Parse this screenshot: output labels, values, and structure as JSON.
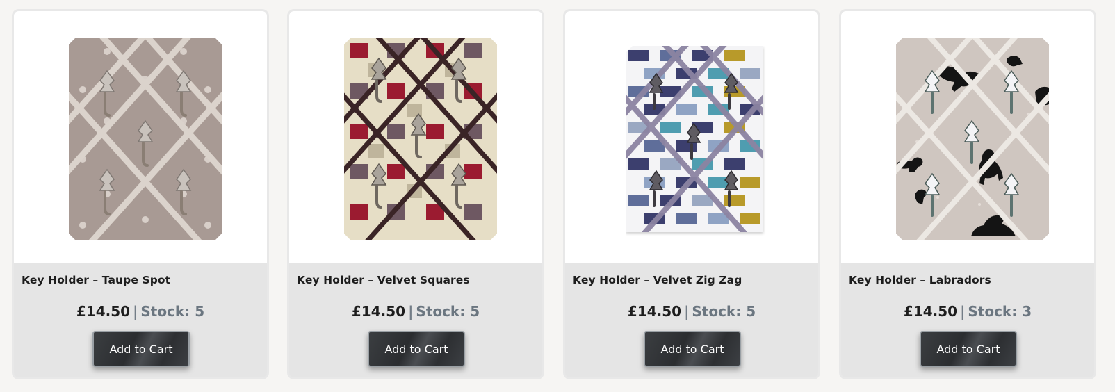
{
  "products": [
    {
      "title": "Key Holder – Taupe Spot",
      "price": "£14.50",
      "separator": "|",
      "stock": "Stock: 5",
      "button": "Add to Cart",
      "image_icon": "taupe-spot-key-holder-icon",
      "colors": {
        "fabric": "#a89a94",
        "ribbon": "#d9d0c9",
        "accent": "#e6dfd9"
      }
    },
    {
      "title": "Key Holder – Velvet Squares",
      "price": "£14.50",
      "separator": "|",
      "stock": "Stock: 5",
      "button": "Add to Cart",
      "image_icon": "velvet-squares-key-holder-icon",
      "colors": {
        "fabric": "#e8e0c8",
        "ribbon": "#3a2426",
        "accent": "#9b1b30"
      }
    },
    {
      "title": "Key Holder – Velvet Zig Zag",
      "price": "£14.50",
      "separator": "|",
      "stock": "Stock: 5",
      "button": "Add to Cart",
      "image_icon": "velvet-zig-zag-key-holder-icon",
      "colors": {
        "fabric": "#f2f2f4",
        "ribbon": "#6d6580",
        "accent": "#4f9db0"
      }
    },
    {
      "title": "Key Holder – Labradors",
      "price": "£14.50",
      "separator": "|",
      "stock": "Stock: 3",
      "button": "Add to Cart",
      "image_icon": "labradors-key-holder-icon",
      "colors": {
        "fabric": "#cfc6c0",
        "ribbon": "#ebe7e2",
        "accent": "#1a1a1a"
      }
    }
  ]
}
